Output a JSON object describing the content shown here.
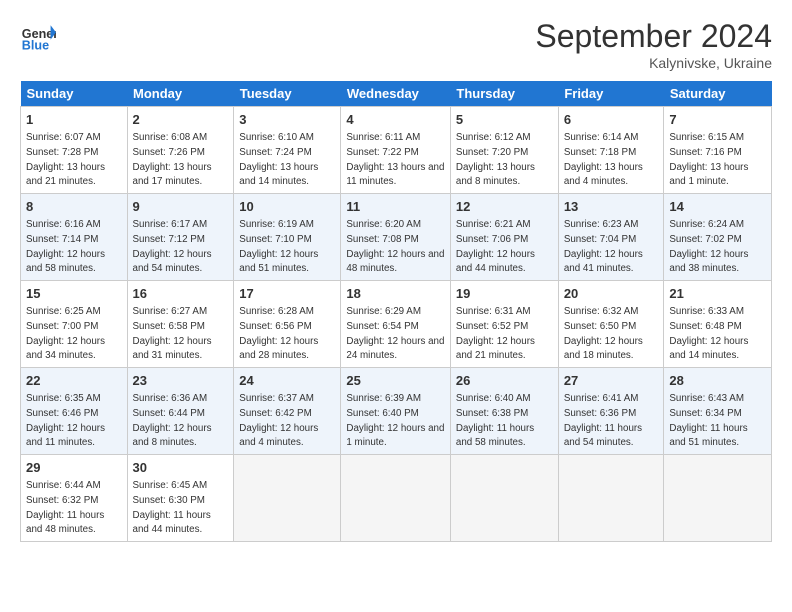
{
  "header": {
    "logo_line1": "General",
    "logo_line2": "Blue",
    "month": "September 2024",
    "location": "Kalynivske, Ukraine"
  },
  "days_of_week": [
    "Sunday",
    "Monday",
    "Tuesday",
    "Wednesday",
    "Thursday",
    "Friday",
    "Saturday"
  ],
  "weeks": [
    [
      {
        "day": "1",
        "sunrise": "6:07 AM",
        "sunset": "7:28 PM",
        "daylight": "13 hours and 21 minutes."
      },
      {
        "day": "2",
        "sunrise": "6:08 AM",
        "sunset": "7:26 PM",
        "daylight": "13 hours and 17 minutes."
      },
      {
        "day": "3",
        "sunrise": "6:10 AM",
        "sunset": "7:24 PM",
        "daylight": "13 hours and 14 minutes."
      },
      {
        "day": "4",
        "sunrise": "6:11 AM",
        "sunset": "7:22 PM",
        "daylight": "13 hours and 11 minutes."
      },
      {
        "day": "5",
        "sunrise": "6:12 AM",
        "sunset": "7:20 PM",
        "daylight": "13 hours and 8 minutes."
      },
      {
        "day": "6",
        "sunrise": "6:14 AM",
        "sunset": "7:18 PM",
        "daylight": "13 hours and 4 minutes."
      },
      {
        "day": "7",
        "sunrise": "6:15 AM",
        "sunset": "7:16 PM",
        "daylight": "13 hours and 1 minute."
      }
    ],
    [
      {
        "day": "8",
        "sunrise": "6:16 AM",
        "sunset": "7:14 PM",
        "daylight": "12 hours and 58 minutes."
      },
      {
        "day": "9",
        "sunrise": "6:17 AM",
        "sunset": "7:12 PM",
        "daylight": "12 hours and 54 minutes."
      },
      {
        "day": "10",
        "sunrise": "6:19 AM",
        "sunset": "7:10 PM",
        "daylight": "12 hours and 51 minutes."
      },
      {
        "day": "11",
        "sunrise": "6:20 AM",
        "sunset": "7:08 PM",
        "daylight": "12 hours and 48 minutes."
      },
      {
        "day": "12",
        "sunrise": "6:21 AM",
        "sunset": "7:06 PM",
        "daylight": "12 hours and 44 minutes."
      },
      {
        "day": "13",
        "sunrise": "6:23 AM",
        "sunset": "7:04 PM",
        "daylight": "12 hours and 41 minutes."
      },
      {
        "day": "14",
        "sunrise": "6:24 AM",
        "sunset": "7:02 PM",
        "daylight": "12 hours and 38 minutes."
      }
    ],
    [
      {
        "day": "15",
        "sunrise": "6:25 AM",
        "sunset": "7:00 PM",
        "daylight": "12 hours and 34 minutes."
      },
      {
        "day": "16",
        "sunrise": "6:27 AM",
        "sunset": "6:58 PM",
        "daylight": "12 hours and 31 minutes."
      },
      {
        "day": "17",
        "sunrise": "6:28 AM",
        "sunset": "6:56 PM",
        "daylight": "12 hours and 28 minutes."
      },
      {
        "day": "18",
        "sunrise": "6:29 AM",
        "sunset": "6:54 PM",
        "daylight": "12 hours and 24 minutes."
      },
      {
        "day": "19",
        "sunrise": "6:31 AM",
        "sunset": "6:52 PM",
        "daylight": "12 hours and 21 minutes."
      },
      {
        "day": "20",
        "sunrise": "6:32 AM",
        "sunset": "6:50 PM",
        "daylight": "12 hours and 18 minutes."
      },
      {
        "day": "21",
        "sunrise": "6:33 AM",
        "sunset": "6:48 PM",
        "daylight": "12 hours and 14 minutes."
      }
    ],
    [
      {
        "day": "22",
        "sunrise": "6:35 AM",
        "sunset": "6:46 PM",
        "daylight": "12 hours and 11 minutes."
      },
      {
        "day": "23",
        "sunrise": "6:36 AM",
        "sunset": "6:44 PM",
        "daylight": "12 hours and 8 minutes."
      },
      {
        "day": "24",
        "sunrise": "6:37 AM",
        "sunset": "6:42 PM",
        "daylight": "12 hours and 4 minutes."
      },
      {
        "day": "25",
        "sunrise": "6:39 AM",
        "sunset": "6:40 PM",
        "daylight": "12 hours and 1 minute."
      },
      {
        "day": "26",
        "sunrise": "6:40 AM",
        "sunset": "6:38 PM",
        "daylight": "11 hours and 58 minutes."
      },
      {
        "day": "27",
        "sunrise": "6:41 AM",
        "sunset": "6:36 PM",
        "daylight": "11 hours and 54 minutes."
      },
      {
        "day": "28",
        "sunrise": "6:43 AM",
        "sunset": "6:34 PM",
        "daylight": "11 hours and 51 minutes."
      }
    ],
    [
      {
        "day": "29",
        "sunrise": "6:44 AM",
        "sunset": "6:32 PM",
        "daylight": "11 hours and 48 minutes."
      },
      {
        "day": "30",
        "sunrise": "6:45 AM",
        "sunset": "6:30 PM",
        "daylight": "11 hours and 44 minutes."
      },
      null,
      null,
      null,
      null,
      null
    ]
  ]
}
